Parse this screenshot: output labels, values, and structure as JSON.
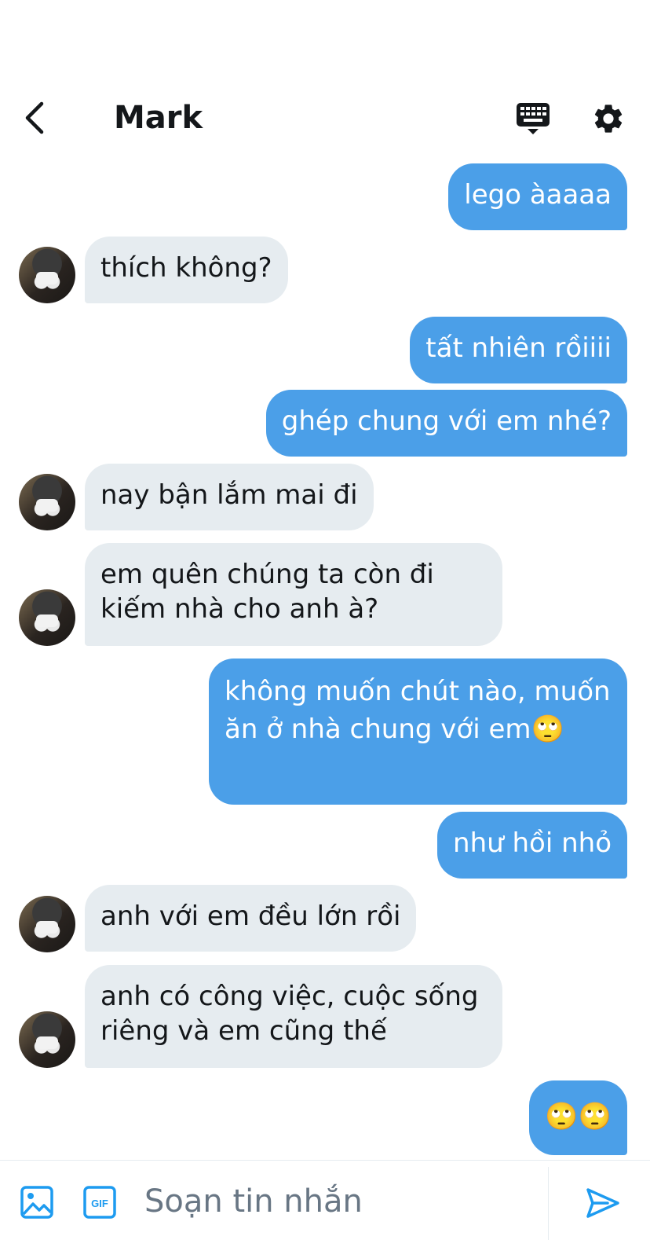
{
  "header": {
    "title": "Mark",
    "icons": {
      "back": "chevron-left-icon",
      "keyboard": "keyboard-icon",
      "settings": "gear-icon"
    }
  },
  "messages": [
    {
      "from": "me",
      "text": "lego àaaaa"
    },
    {
      "from": "Mark",
      "text": "thích không?"
    },
    {
      "from": "me",
      "text": "tất nhiên rồiiii"
    },
    {
      "from": "me",
      "text": "ghép chung với em nhé?"
    },
    {
      "from": "Mark",
      "text": "nay bận lắm mai đi"
    },
    {
      "from": "Mark",
      "text": "em quên chúng ta còn đi kiếm nhà cho anh à?"
    },
    {
      "from": "me",
      "text": "không muốn chút nào, muốn ăn ở nhà chung với em🙄"
    },
    {
      "from": "me",
      "text": "như hồi nhỏ"
    },
    {
      "from": "Mark",
      "text": "anh với em đều lớn rồi"
    },
    {
      "from": "Mark",
      "text": "anh có công việc, cuộc sống riêng và em cũng thế"
    },
    {
      "from": "me",
      "text": "🙄🙄"
    }
  ],
  "composer": {
    "placeholder": "Soạn tin nhắn",
    "value": "",
    "gif_label": "GIF",
    "icons": {
      "image": "image-icon",
      "gif": "gif-icon",
      "send": "send-icon"
    }
  },
  "colors": {
    "outgoing_bubble": "#4b9fe8",
    "incoming_bubble": "#e6ecf0",
    "accent": "#1d9bf0",
    "text": "#14171a",
    "placeholder": "#687684"
  }
}
